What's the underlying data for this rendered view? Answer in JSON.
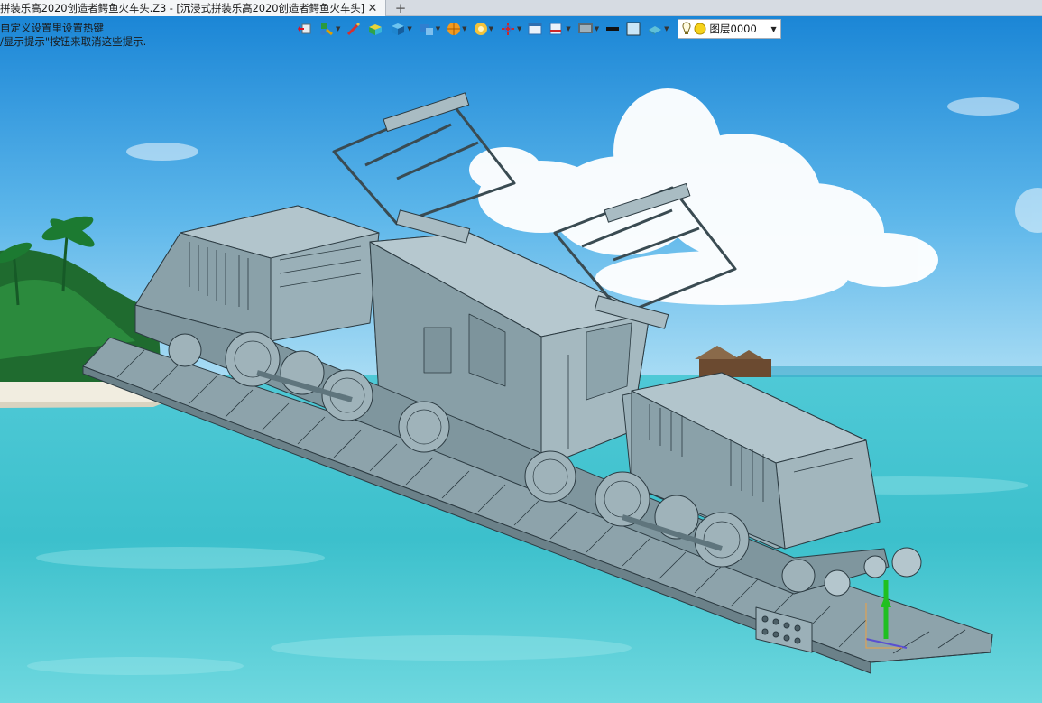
{
  "tab": {
    "title": "拼装乐高2020创造者鳄鱼火车头.Z3 - [沉浸式拼装乐高2020创造者鳄鱼火车头]",
    "close_glyph": "✕",
    "add_glyph": "+"
  },
  "hints": {
    "line1": "自定义设置里设置热键",
    "line2": "/显示提示\"按钮来取消这些提示."
  },
  "toolbar": {
    "icons": [
      "undo-icon",
      "pick-filter-icon",
      "sketch-icon",
      "solid-box-icon",
      "cube-view-icon",
      "part-icon",
      "render-sphere-icon",
      "snap-icon",
      "axis-icon",
      "window-icon",
      "dimension-icon",
      "display-icon",
      "line-color-icon",
      "fill-color-icon",
      "material-icon"
    ],
    "layer": {
      "name": "图层0000",
      "icons": [
        "light-bulb-icon",
        "sun-icon"
      ]
    }
  },
  "colors": {
    "sky_top": "#1f8fdc",
    "sea": "#47c7cf",
    "model": "#8ea7b0"
  }
}
